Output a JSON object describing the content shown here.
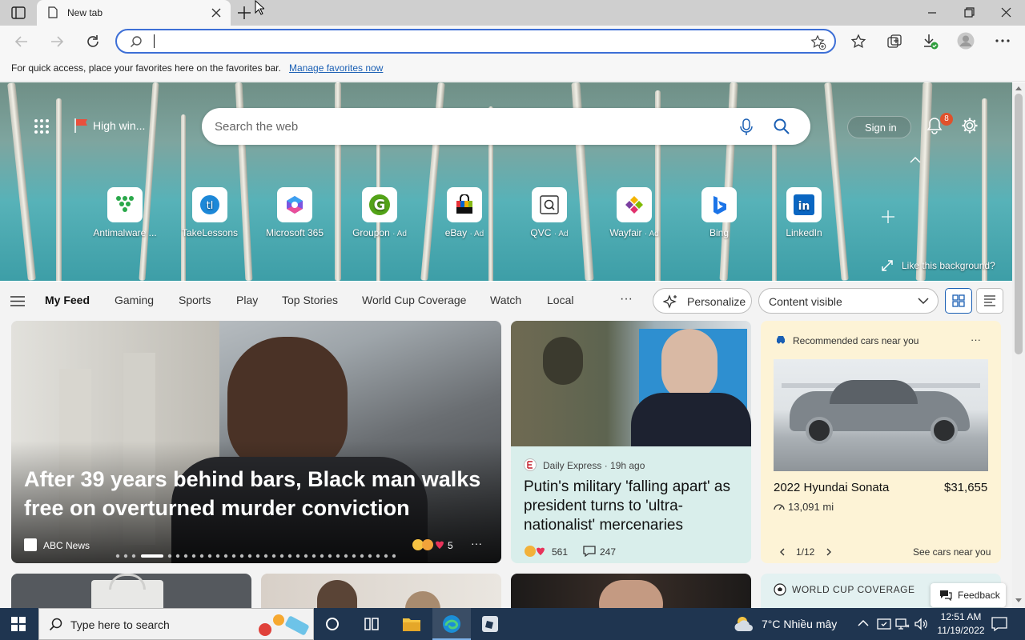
{
  "browser": {
    "tab_title": "New tab",
    "favorites_bar_text": "For quick access, place your favorites here on the favorites bar.",
    "favorites_bar_link": "Manage favorites now"
  },
  "hero": {
    "weather_label": "High win...",
    "search_placeholder": "Search the web",
    "sign_in": "Sign in",
    "notification_count": "8",
    "like_background": "Like this background?",
    "quick_links": [
      {
        "label": "Antimalware ...",
        "ad": ""
      },
      {
        "label": "TakeLessons",
        "ad": ""
      },
      {
        "label": "Microsoft 365",
        "ad": ""
      },
      {
        "label": "Groupon",
        "ad": "· Ad"
      },
      {
        "label": "eBay",
        "ad": "· Ad"
      },
      {
        "label": "QVC",
        "ad": "· Ad"
      },
      {
        "label": "Wayfair",
        "ad": "· Ad"
      },
      {
        "label": "Bing",
        "ad": ""
      },
      {
        "label": "LinkedIn",
        "ad": ""
      }
    ]
  },
  "feed_nav": {
    "items": [
      "My Feed",
      "Gaming",
      "Sports",
      "Play",
      "Top Stories",
      "World Cup Coverage",
      "Watch",
      "Local"
    ],
    "more": "···",
    "personalize": "Personalize",
    "content_visible": "Content visible"
  },
  "cards": {
    "main": {
      "headline": "After 39 years behind bars, Black man walks free on overturned murder conviction",
      "source": "ABC News",
      "reactions": "5"
    },
    "putin": {
      "source": "Daily Express · 19h ago",
      "headline": "Putin's military 'falling apart' as president turns to 'ultra-nationalist' mercenaries",
      "reactions": "561",
      "comments": "247"
    },
    "cars": {
      "header": "Recommended cars near you",
      "model": "2022 Hyundai Sonata",
      "price": "$31,655",
      "mileage": "13,091 mi",
      "pager": "1/12",
      "see_more": "See cars near you"
    },
    "world_cup": {
      "header": "WORLD CUP COVERAGE"
    },
    "feedback": "Feedback"
  },
  "taskbar": {
    "search_placeholder": "Type here to search",
    "weather": "7°C  Nhiều mây",
    "time": "12:51 AM",
    "date": "11/19/2022"
  }
}
